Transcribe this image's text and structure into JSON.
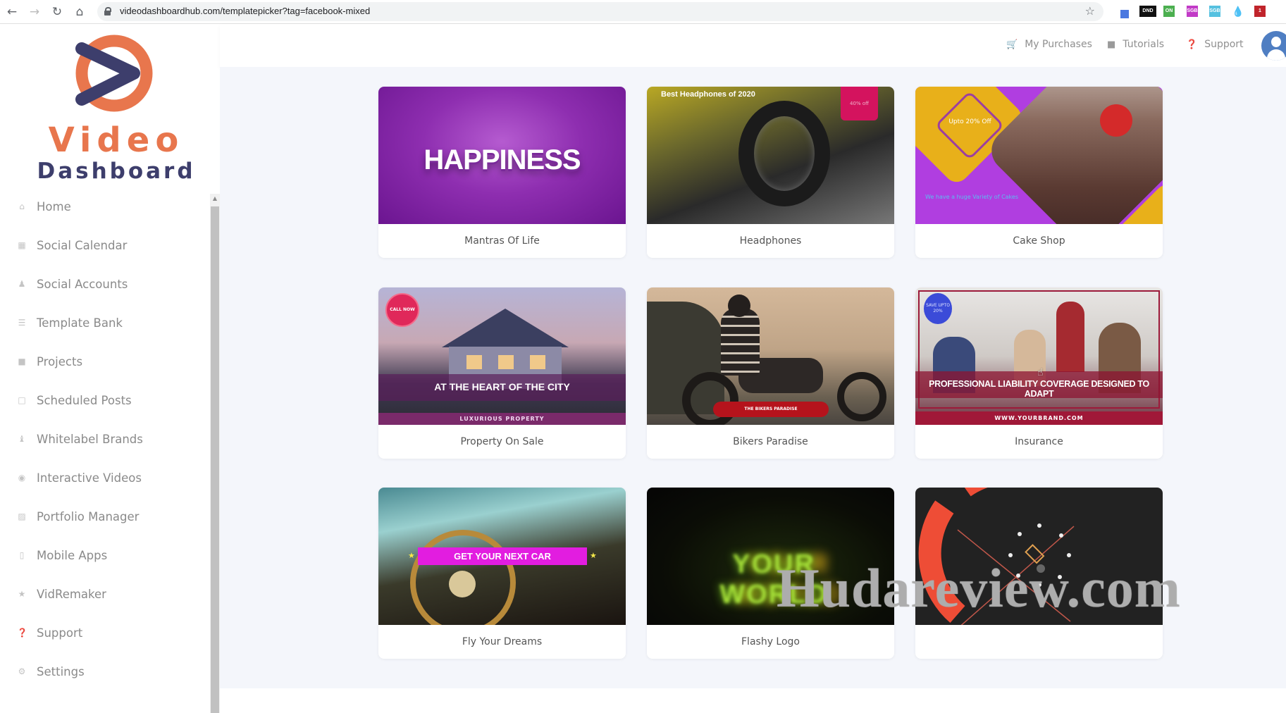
{
  "browser": {
    "url": "videodashboardhub.com/templatepicker?tag=facebook-mixed",
    "extensions": [
      {
        "name": "eyedropper",
        "label": "",
        "color": "#4a78e0"
      },
      {
        "name": "dnd",
        "label": "DND",
        "color": "#111111"
      },
      {
        "name": "on",
        "label": "ON",
        "color": "#4caf50"
      },
      {
        "name": "sgb-pink",
        "label": "SGB",
        "color": "#c23bc7"
      },
      {
        "name": "sgb-blue",
        "label": "SGB",
        "color": "#56c1e0"
      },
      {
        "name": "drop",
        "label": "",
        "color": "#1a57d0"
      },
      {
        "name": "lastpass",
        "label": "1",
        "color": "#c0242b"
      }
    ]
  },
  "logo": {
    "word1": "Video",
    "word2": "Dashboard",
    "colors": {
      "orange": "#e8764d",
      "navy": "#3d3e6c"
    }
  },
  "sidebar": {
    "items": [
      {
        "label": "Home",
        "icon": "home-icon"
      },
      {
        "label": "Social Calendar",
        "icon": "calendar-icon"
      },
      {
        "label": "Social Accounts",
        "icon": "user-icon"
      },
      {
        "label": "Template Bank",
        "icon": "list-icon"
      },
      {
        "label": "Projects",
        "icon": "video-camera-icon"
      },
      {
        "label": "Scheduled Posts",
        "icon": "calendar-blank-icon"
      },
      {
        "label": "Whitelabel Brands",
        "icon": "users-icon"
      },
      {
        "label": "Interactive Videos",
        "icon": "play-circle-icon"
      },
      {
        "label": "Portfolio Manager",
        "icon": "image-icon"
      },
      {
        "label": "Mobile Apps",
        "icon": "mobile-icon"
      },
      {
        "label": "VidRemaker",
        "icon": "star-icon"
      },
      {
        "label": "Support",
        "icon": "question-circle-icon"
      },
      {
        "label": "Settings",
        "icon": "gear-icon"
      }
    ]
  },
  "topbar": {
    "links": [
      {
        "label": "My Purchases",
        "icon": "cart-icon"
      },
      {
        "label": "Tutorials",
        "icon": "video-camera-icon"
      },
      {
        "label": "Support",
        "icon": "question-circle-icon"
      }
    ]
  },
  "templates": [
    {
      "title": "Mantras Of Life",
      "thumb_text": [
        "HAPPINESS"
      ]
    },
    {
      "title": "Headphones",
      "thumb_text": [
        "Best Headphones of 2020",
        "40% off"
      ]
    },
    {
      "title": "Cake Shop",
      "thumb_text": [
        "Upto 20% Off",
        "We have a huge Variety of Cakes"
      ]
    },
    {
      "title": "Property On Sale",
      "thumb_text": [
        "CALL NOW",
        "AT THE HEART OF THE CITY",
        "LUXURIOUS PROPERTY"
      ]
    },
    {
      "title": "Bikers Paradise",
      "thumb_text": [
        "THE BIKERS PARADISE"
      ]
    },
    {
      "title": "Insurance",
      "thumb_text": [
        "SAVE UPTO 20%",
        "PROFESSIONAL LIABILITY COVERAGE DESIGNED TO ADAPT",
        "WWW.YOURBRAND.COM"
      ]
    },
    {
      "title": "Fly Your Dreams",
      "thumb_text": [
        "GET YOUR NEXT CAR"
      ]
    },
    {
      "title": "Flashy Logo",
      "thumb_text": [
        "YOUR WORLD"
      ]
    },
    {
      "title": "",
      "thumb_text": []
    }
  ],
  "watermark": "Hudareview.com"
}
